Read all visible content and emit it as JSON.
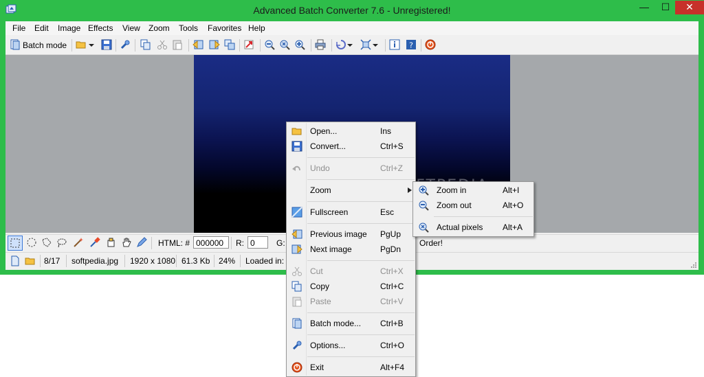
{
  "window": {
    "title": "Advanced Batch Converter 7.6 - Unregistered!",
    "controls": {
      "minimize": "—",
      "maximize": "☐",
      "close": "✕"
    },
    "accent_color": "#2ebd4a"
  },
  "menubar": {
    "items": [
      "File",
      "Edit",
      "Image",
      "Effects",
      "View",
      "Zoom",
      "Tools",
      "Favorites",
      "Help"
    ]
  },
  "toolbar": {
    "batch_mode_label": "Batch mode",
    "icons": [
      "batch-mode-icon",
      "open-folder-icon",
      "dropdown-arrow-icon",
      "save-icon",
      "options-icon",
      "copy-icon",
      "cut-icon",
      "paste-icon",
      "previous-image-icon",
      "next-image-icon",
      "thumbnails-icon",
      "undo-icon",
      "zoom-out-icon",
      "actual-pixels-icon",
      "zoom-in-icon",
      "print-icon",
      "rotate-icon",
      "fit-icon",
      "info-icon",
      "help-icon",
      "exit-icon"
    ]
  },
  "selection_toolbar": {
    "tools": [
      "rectangle-select-icon",
      "ellipse-select-icon",
      "polygon-select-icon",
      "lasso-select-icon",
      "magic-wand-icon",
      "color-picker-icon",
      "paint-bucket-icon",
      "hand-pan-icon",
      "pencil-icon"
    ],
    "html_label": "HTML: #",
    "html_value": "000000",
    "r_label": "R:",
    "r_value": "0",
    "g_label": "G:",
    "order_text": "Order!"
  },
  "statusbar": {
    "position": "8/17",
    "filename": "softpedia.jpg",
    "dimensions": "1920 x 1080",
    "filesize": "61.3 Kb",
    "zoom": "24%",
    "loaded": "Loaded in: ("
  },
  "context_menu": {
    "items": [
      {
        "label": "Open...",
        "shortcut": "Ins",
        "icon": "open-folder-icon"
      },
      {
        "label": "Convert...",
        "shortcut": "Ctrl+S",
        "icon": "save-icon"
      },
      {
        "label": "Undo",
        "shortcut": "Ctrl+Z",
        "icon": "undo-icon",
        "disabled": true
      },
      {
        "label": "Zoom",
        "shortcut": "",
        "icon": "",
        "submenu": true
      },
      {
        "label": "Fullscreen",
        "shortcut": "Esc",
        "icon": "fullscreen-icon"
      },
      {
        "label": "Previous image",
        "shortcut": "PgUp",
        "icon": "previous-image-icon"
      },
      {
        "label": "Next image",
        "shortcut": "PgDn",
        "icon": "next-image-icon"
      },
      {
        "label": "Cut",
        "shortcut": "Ctrl+X",
        "icon": "cut-icon",
        "disabled": true
      },
      {
        "label": "Copy",
        "shortcut": "Ctrl+C",
        "icon": "copy-icon"
      },
      {
        "label": "Paste",
        "shortcut": "Ctrl+V",
        "icon": "paste-icon",
        "disabled": true
      },
      {
        "label": "Batch mode...",
        "shortcut": "Ctrl+B",
        "icon": "batch-mode-icon"
      },
      {
        "label": "Options...",
        "shortcut": "Ctrl+O",
        "icon": "options-icon"
      },
      {
        "label": "Exit",
        "shortcut": "Alt+F4",
        "icon": "exit-icon"
      }
    ]
  },
  "zoom_submenu": {
    "items": [
      {
        "label": "Zoom in",
        "shortcut": "Alt+I",
        "icon": "zoom-in-icon"
      },
      {
        "label": "Zoom out",
        "shortcut": "Alt+O",
        "icon": "zoom-out-icon"
      },
      {
        "label": "Actual pixels",
        "shortcut": "Alt+A",
        "icon": "actual-pixels-icon"
      }
    ]
  },
  "watermark": "SOFTPEDIA"
}
